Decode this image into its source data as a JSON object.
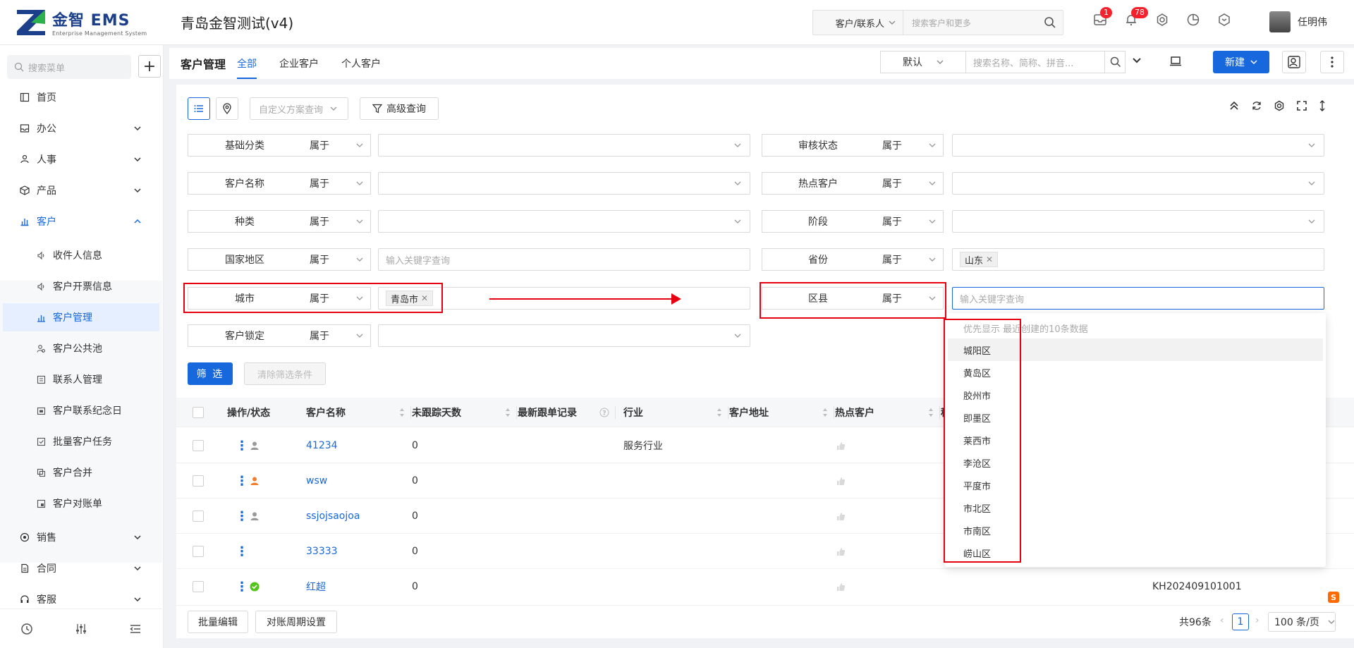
{
  "header": {
    "logo_name": "金智 EMS",
    "logo_sub": "Enterprise Management System",
    "app_title": "青岛金智测试(v4)",
    "search_scope": "客户/联系人",
    "search_placeholder": "搜索客户和更多",
    "badge_todo": "1",
    "badge_notice": "78",
    "user_name": "任明伟"
  },
  "sidebar": {
    "search_placeholder": "搜索菜单",
    "nav": [
      {
        "label": "首页"
      },
      {
        "label": "办公"
      },
      {
        "label": "人事"
      },
      {
        "label": "产品"
      },
      {
        "label": "客户"
      },
      {
        "label": "销售"
      },
      {
        "label": "合同"
      },
      {
        "label": "客服"
      }
    ],
    "sub_items": [
      {
        "label": "收件人信息"
      },
      {
        "label": "客户开票信息"
      },
      {
        "label": "客户管理"
      },
      {
        "label": "客户公共池"
      },
      {
        "label": "联系人管理"
      },
      {
        "label": "客户联系纪念日"
      },
      {
        "label": "批量客户任务"
      },
      {
        "label": "客户合并"
      },
      {
        "label": "客户对账单"
      }
    ]
  },
  "subheader": {
    "title": "客户管理",
    "tabs": [
      {
        "label": "全部"
      },
      {
        "label": "企业客户"
      },
      {
        "label": "个人客户"
      }
    ],
    "view_select": "默认",
    "search_placeholder": "搜索名称、简称、拼音...",
    "new_button": "新建"
  },
  "toolbar": {
    "scheme_placeholder": "自定义方案查询",
    "advanced_query": "高级查询"
  },
  "filters": {
    "operator": "属于",
    "left": [
      {
        "label": "基础分类",
        "value": ""
      },
      {
        "label": "客户名称",
        "value": ""
      },
      {
        "label": "种类",
        "value": ""
      },
      {
        "label": "国家地区",
        "placeholder": "输入关键字查询"
      },
      {
        "label": "城市",
        "tag": "青岛市"
      },
      {
        "label": "客户锁定",
        "value": ""
      }
    ],
    "right": [
      {
        "label": "审核状态",
        "value": ""
      },
      {
        "label": "热点客户",
        "value": ""
      },
      {
        "label": "阶段",
        "value": ""
      },
      {
        "label": "省份",
        "tag": "山东"
      },
      {
        "label": "区县",
        "placeholder": "输入关键字查询"
      }
    ],
    "filter_button": "筛 选",
    "clear_button": "清除筛选条件"
  },
  "dropdown": {
    "hint": "优先显示 最近创建的10条数据",
    "options": [
      "城阳区",
      "黄岛区",
      "胶州市",
      "即墨区",
      "莱西市",
      "李沧区",
      "平度市",
      "市北区",
      "市南区",
      "崂山区"
    ]
  },
  "table": {
    "columns": [
      "操作/状态",
      "客户名称",
      "未跟踪天数",
      "最新跟单记录",
      "行业",
      "客户地址",
      "热点客户",
      "种"
    ],
    "rows": [
      {
        "name": "41234",
        "days": "0",
        "industry": "服务行业",
        "code": ""
      },
      {
        "name": "wsw",
        "days": "0",
        "industry": "",
        "code": ""
      },
      {
        "name": "ssjojsaojoa",
        "days": "0",
        "industry": "",
        "code": ""
      },
      {
        "name": "33333",
        "days": "0",
        "industry": "",
        "code": ""
      },
      {
        "name": "红超",
        "days": "0",
        "industry": "",
        "code": "KH202409101001"
      }
    ]
  },
  "footer": {
    "batch_edit": "批量编辑",
    "period_setting": "对账周期设置",
    "total": "共96条",
    "page": "1",
    "page_size": "100 条/页"
  }
}
